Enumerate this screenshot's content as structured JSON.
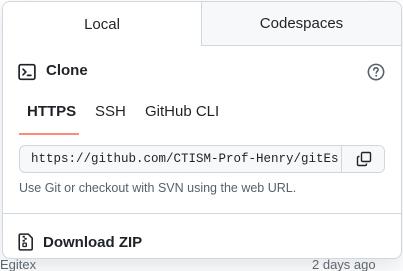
{
  "background": {
    "left_text": "Egitex",
    "right_text": "2 days ago"
  },
  "tabs": [
    {
      "label": "Local",
      "selected": true
    },
    {
      "label": "Codespaces",
      "selected": false
    }
  ],
  "clone": {
    "title": "Clone",
    "icon": "terminal-icon",
    "help_icon": "question-circle-icon"
  },
  "protocols": [
    {
      "label": "HTTPS",
      "selected": true
    },
    {
      "label": "SSH",
      "selected": false
    },
    {
      "label": "GitHub CLI",
      "selected": false
    }
  ],
  "url": {
    "value": "https://github.com/CTISM-Prof-Henry/gitEs",
    "copy_icon": "copy-icon"
  },
  "hint": "Use Git or checkout with SVN using the web URL.",
  "download": {
    "label": "Download ZIP",
    "icon": "file-zip-icon"
  },
  "colors": {
    "accent_underline": "#fd8c73",
    "border": "#d0d7de",
    "muted_text": "#57606a"
  }
}
